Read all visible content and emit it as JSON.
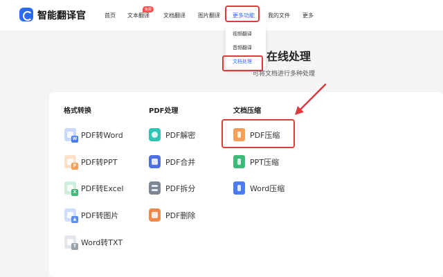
{
  "header": {
    "brand": "智能翻译官",
    "nav": [
      "首页",
      "文本翻译",
      "文档翻译",
      "图片翻译",
      "更多功能",
      "我的文件",
      "更多"
    ],
    "badge": "免费"
  },
  "dropdown": {
    "items": [
      "视频翻译",
      "音频翻译",
      "文档处理"
    ]
  },
  "page": {
    "title": "在线处理",
    "subtitle": "可将文档进行多种处理"
  },
  "columns": [
    {
      "heading": "格式转换",
      "tools": [
        "PDF转Word",
        "PDF转PPT",
        "PDF转Excel",
        "PDF转图片",
        "Word转TXT"
      ]
    },
    {
      "heading": "PDF处理",
      "tools": [
        "PDF解密",
        "PDF合并",
        "PDF拆分",
        "PDF删除"
      ]
    },
    {
      "heading": "文档压缩",
      "tools": [
        "PDF压缩",
        "PPT压缩",
        "Word压缩"
      ]
    }
  ],
  "colors": {
    "accent": "#2b6af3",
    "highlight": "#e03a3a",
    "word": "#4a7bf0",
    "ppt": "#f5a05a",
    "excel": "#3fb97a",
    "image": "#5a8ff0",
    "txt": "#9aa3ad",
    "teal": "#2ec4b6",
    "indigo": "#4f6fe0",
    "gray": "#7d8794",
    "orange": "#f0894a"
  }
}
